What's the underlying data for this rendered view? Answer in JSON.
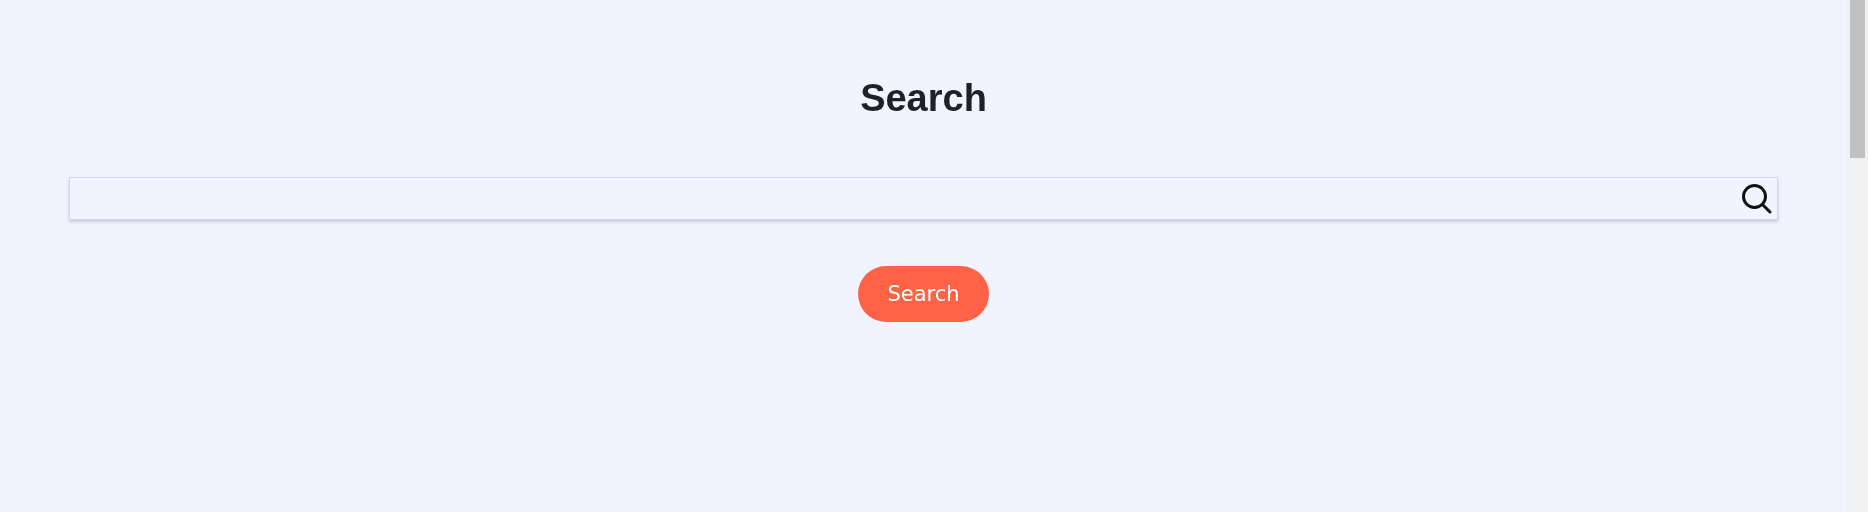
{
  "title": "Search",
  "search": {
    "button": "Search"
  }
}
